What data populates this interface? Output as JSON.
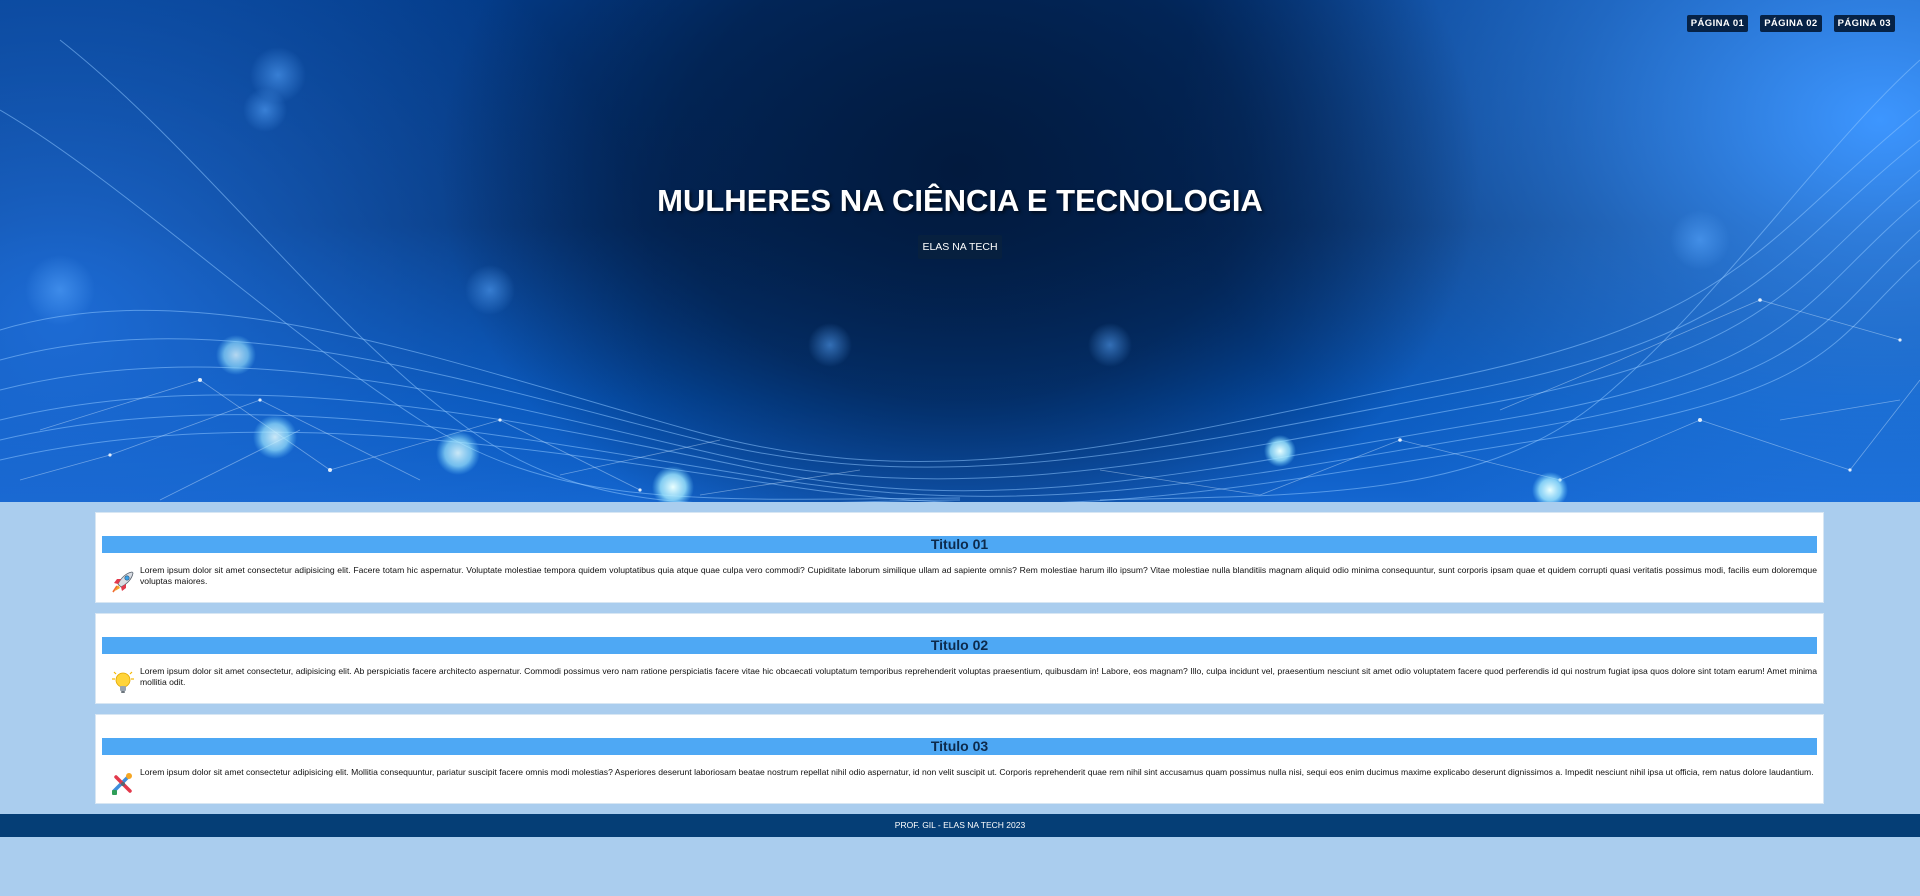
{
  "nav": {
    "items": [
      {
        "label": "PÁGINA 01"
      },
      {
        "label": "PÁGINA 02"
      },
      {
        "label": "PÁGINA 03"
      }
    ]
  },
  "hero": {
    "title": "MULHERES NA CIÊNCIA E TECNOLOGIA",
    "button_label": "ELAS NA TECH"
  },
  "cards": [
    {
      "title": "Titulo 01",
      "icon": "rocket-icon",
      "text": "Lorem ipsum dolor sit amet consectetur adipisicing elit. Facere totam hic aspernatur. Voluptate molestiae tempora quidem voluptatibus quia atque quae culpa vero commodi? Cupiditate laborum similique ullam ad sapiente omnis? Rem molestiae harum illo ipsum? Vitae molestiae nulla blanditiis magnam aliquid odio minima consequuntur, sunt corporis ipsam quae et quidem corrupti quasi veritatis possimus modi, facilis eum doloremque voluptas maiores."
    },
    {
      "title": "Titulo 02",
      "icon": "lightbulb-icon",
      "text": "Lorem ipsum dolor sit amet consectetur, adipisicing elit. Ab perspiciatis facere architecto aspernatur. Commodi possimus vero nam ratione perspiciatis facere vitae hic obcaecati voluptatum temporibus reprehenderit voluptas praesentium, quibusdam in! Labore, eos magnam? Illo, culpa incidunt vel, praesentium nesciunt sit amet odio voluptatem facere quod perferendis id qui nostrum fugiat ipsa quos dolore sint totam earum! Amet minima mollitia odit."
    },
    {
      "title": "Titulo 03",
      "icon": "tools-icon",
      "text": "Lorem ipsum dolor sit amet consectetur adipisicing elit. Mollitia consequuntur, pariatur suscipit facere omnis modi molestias? Asperiores deserunt laboriosam beatae nostrum repellat nihil odio aspernatur, id non velit suscipit ut. Corporis reprehenderit quae rem nihil sint accusamus quam possimus nulla nisi, sequi eos enim ducimus maxime explicabo deserunt dignissimos a. Impedit nesciunt nihil ipsa ut officia, rem natus dolore laudantium."
    }
  ],
  "footer": {
    "text": "PROF. GIL - ELAS NA TECH 2023"
  },
  "colors": {
    "page_background": "#aacdee",
    "card_title_bar": "#4ea8f4",
    "footer_background": "#053e76",
    "nav_button": "#062246"
  }
}
